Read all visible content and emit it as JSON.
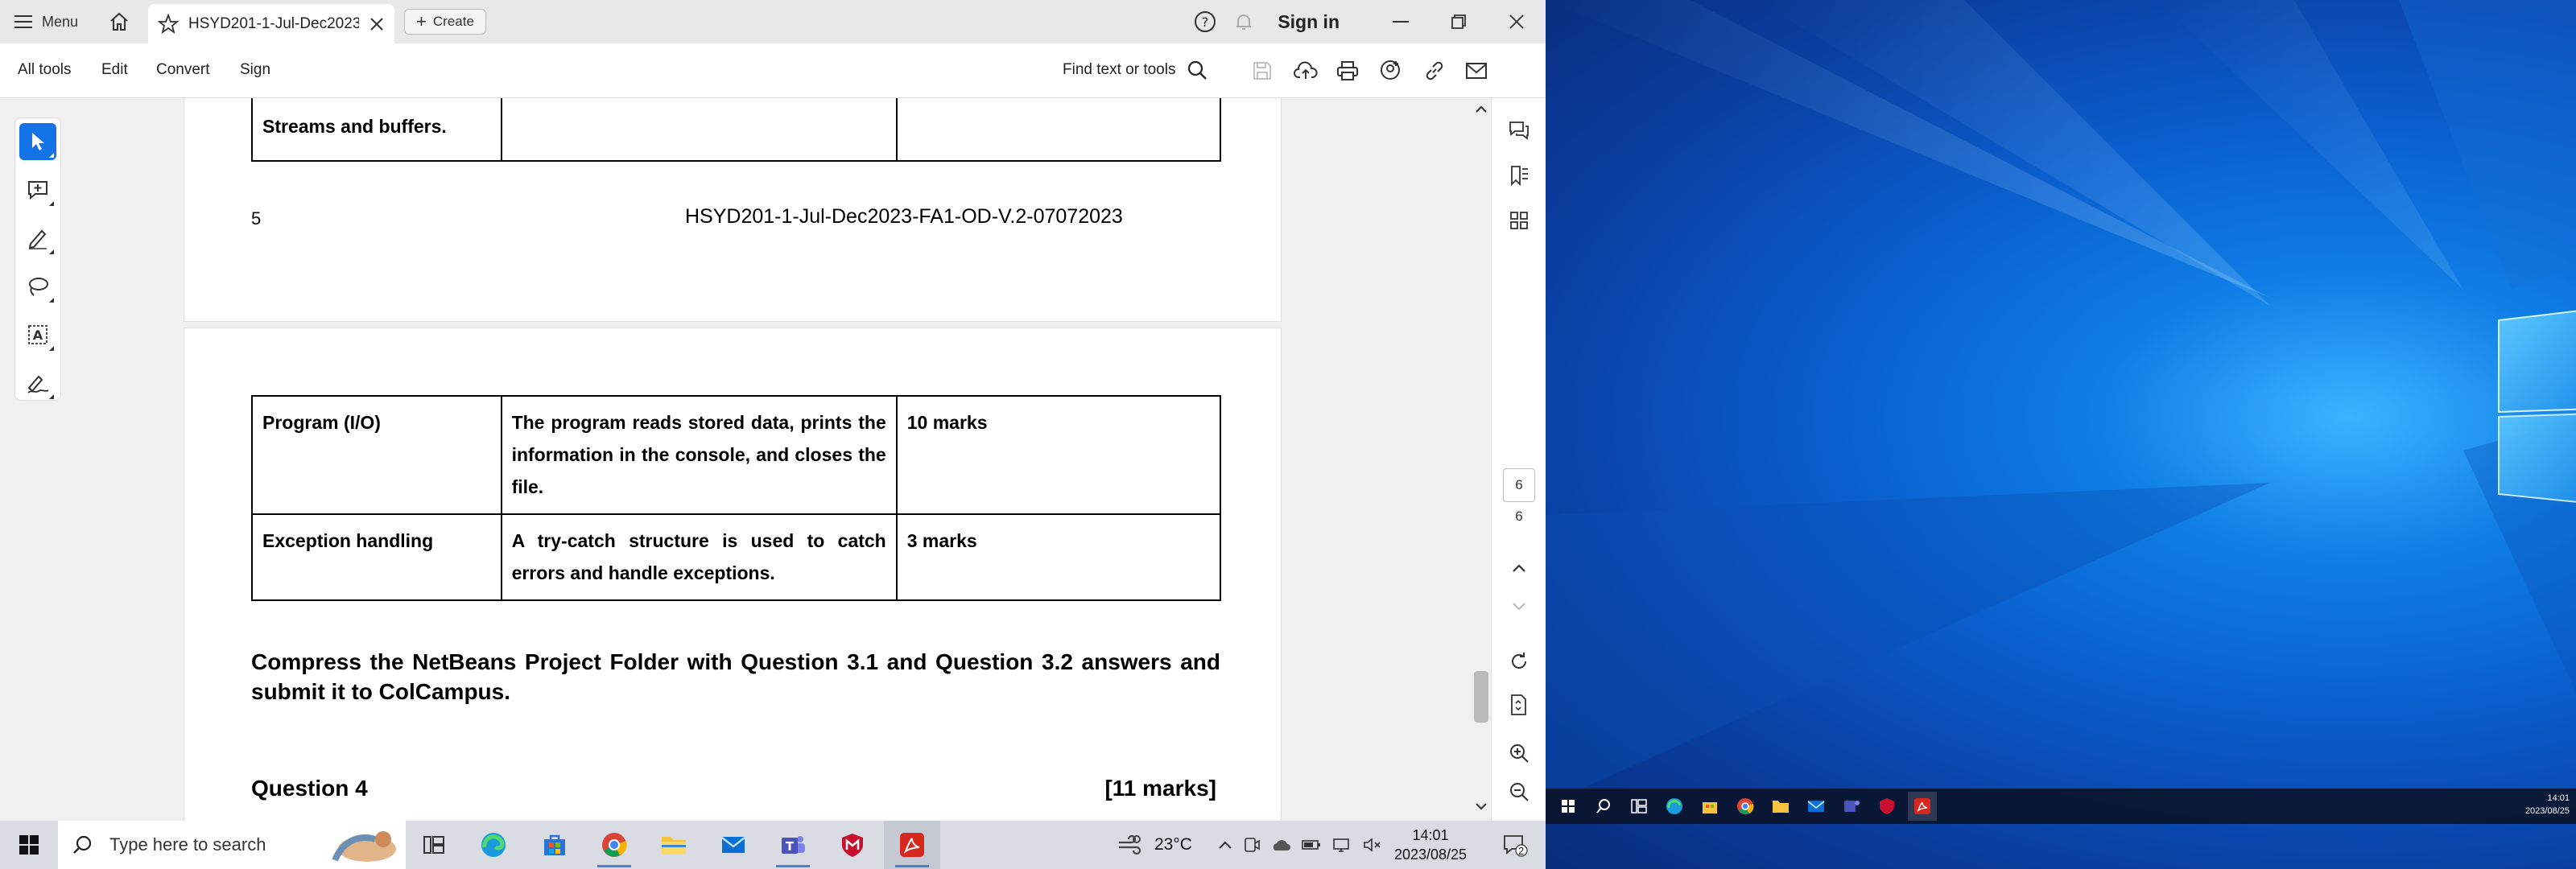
{
  "app": {
    "menu_label": "Menu",
    "tab_title": "HSYD201-1-Jul-Dec2023...",
    "create_label": "Create",
    "sign_in": "Sign in"
  },
  "menubar": {
    "items": [
      "All tools",
      "Edit",
      "Convert",
      "Sign"
    ],
    "find_placeholder": "Find text or tools"
  },
  "document": {
    "top_table_row": "Streams and buffers.",
    "footer_page_number": "5",
    "footer_code": "HSYD201-1-Jul-Dec2023-FA1-OD-V.2-07072023",
    "rubric": [
      {
        "criterion": "Program (I/O)",
        "description": "The program reads stored data, prints the information in the console, and closes the file.",
        "marks": "10 marks"
      },
      {
        "criterion": "Exception handling",
        "description": "A try-catch structure is used to catch errors and handle exceptions.",
        "marks": "3 marks"
      }
    ],
    "instruction": "Compress the NetBeans Project Folder with Question 3.1 and Question 3.2 answers and submit it to ColCampus.",
    "question_title": "Question 4",
    "question_marks": "[11 marks]"
  },
  "rightpanel": {
    "current_page": "6",
    "total_pages": "6"
  },
  "taskbar": {
    "search_placeholder": "Type here to search",
    "temperature": "23°C",
    "time": "14:01",
    "date": "2023/08/25",
    "notification_count": "2"
  },
  "right_taskbar": {
    "time": "14:01",
    "date": "2023/08/25"
  },
  "colors": {
    "accent": "#1473e6",
    "acrobat_red": "#d7281d"
  }
}
